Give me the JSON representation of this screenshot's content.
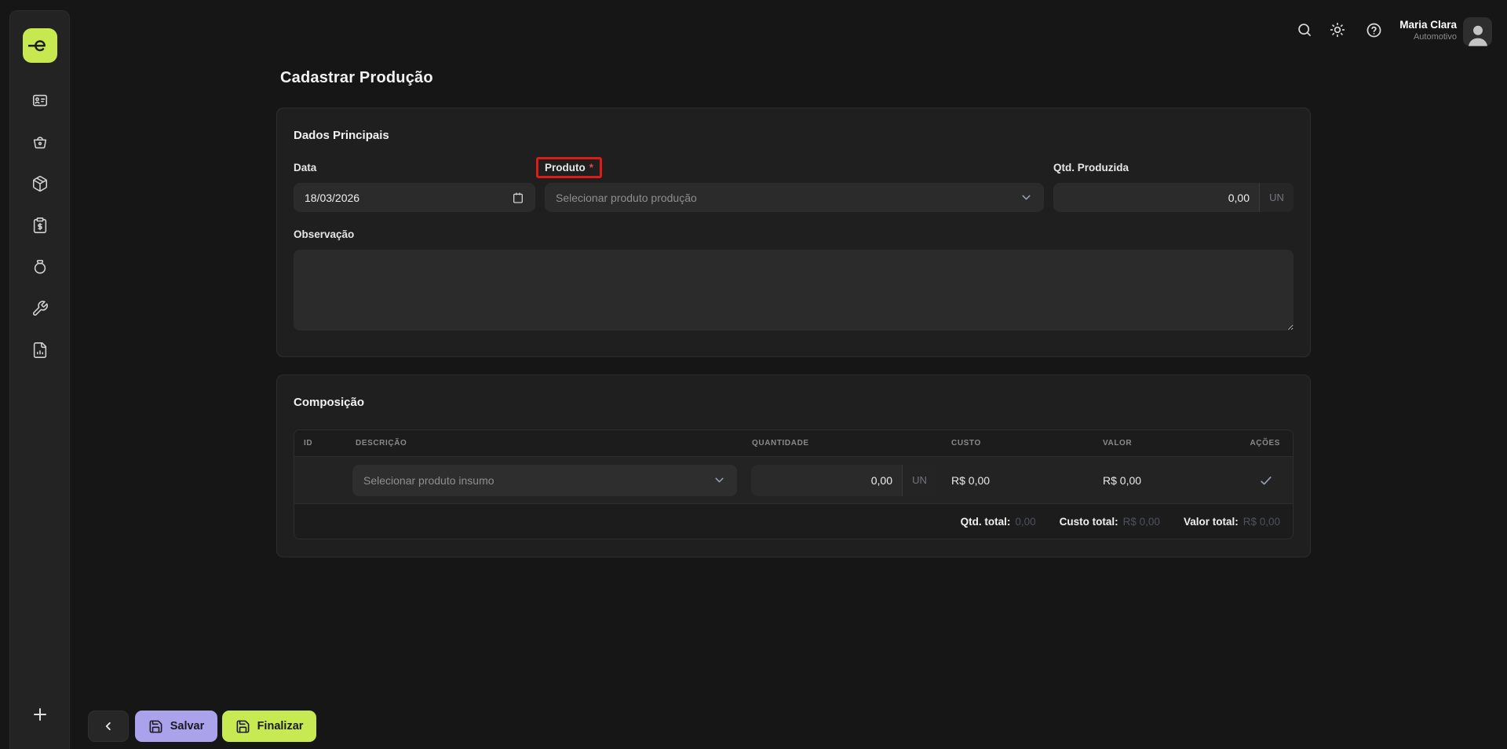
{
  "brand": {
    "logo_letter": "e"
  },
  "topbar": {
    "user": {
      "name": "Maria Clara",
      "role": "Automotivo"
    }
  },
  "page": {
    "title": "Cadastrar Produção"
  },
  "sidebar": {
    "items": [
      {
        "icon": "id-card-icon"
      },
      {
        "icon": "shopping-basket-icon"
      },
      {
        "icon": "package-icon"
      },
      {
        "icon": "clipboard-dollar-icon"
      },
      {
        "icon": "money-bag-icon"
      },
      {
        "icon": "wrench-icon"
      },
      {
        "icon": "report-file-icon"
      }
    ]
  },
  "dados_principais": {
    "title": "Dados Principais",
    "data_field": {
      "label": "Data",
      "value": "18/03/2026"
    },
    "produto_field": {
      "label": "Produto",
      "required_mark": "*",
      "placeholder": "Selecionar produto produção"
    },
    "qtd_field": {
      "label": "Qtd. Produzida",
      "value": "0,00",
      "unit": "UN"
    },
    "observacao_field": {
      "label": "Observação",
      "value": ""
    }
  },
  "composicao": {
    "title": "Composição",
    "headers": {
      "id": "ID",
      "descricao": "DESCRIÇÃO",
      "quantidade": "QUANTIDADE",
      "custo": "CUSTO",
      "valor": "VALOR",
      "acoes": "AÇÕES"
    },
    "row": {
      "descricao_placeholder": "Selecionar produto insumo",
      "quantidade": "0,00",
      "unit": "UN",
      "custo": "R$ 0,00",
      "valor": "R$ 0,00"
    },
    "totals": {
      "qtd_label": "Qtd. total:",
      "qtd_value": "0,00",
      "custo_label": "Custo total:",
      "custo_value": "R$ 0,00",
      "valor_label": "Valor total:",
      "valor_value": "R$ 0,00"
    }
  },
  "actions": {
    "salvar": "Salvar",
    "finalizar": "Finalizar"
  },
  "colors": {
    "accent_lime": "#c7e94f",
    "accent_lavender": "#aaa2eb",
    "highlight_red": "#de1c17"
  }
}
